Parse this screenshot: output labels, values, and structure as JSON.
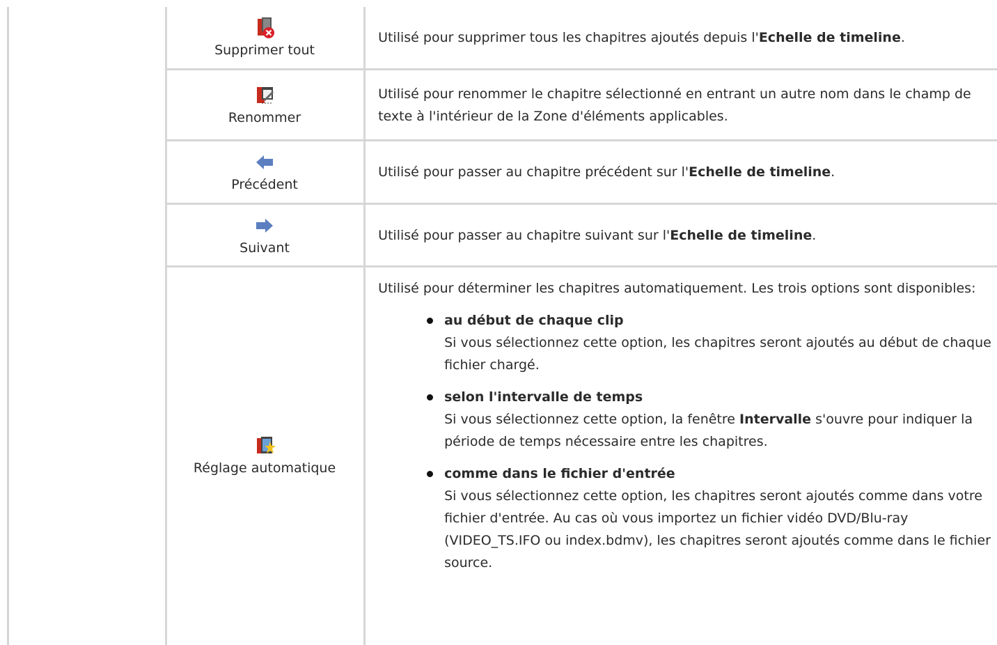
{
  "rows": [
    {
      "label": "Supprimer tout",
      "icon": "delete-all-chapters-icon",
      "desc_pre": "Utilisé pour supprimer tous les chapitres ajoutés depuis l'",
      "desc_bold": "Echelle de timeline",
      "desc_post": "."
    },
    {
      "label": "Renommer",
      "icon": "rename-chapter-icon",
      "desc": "Utilisé pour renommer le chapitre sélectionné en entrant un autre nom dans le champ de texte à l'intérieur de la Zone d'éléments applicables."
    },
    {
      "label": "Précédent",
      "icon": "previous-arrow-icon",
      "desc_pre": "Utilisé pour passer au chapitre précédent sur l'",
      "desc_bold": "Echelle de timeline",
      "desc_post": "."
    },
    {
      "label": "Suivant",
      "icon": "next-arrow-icon",
      "desc_pre": "Utilisé pour passer au chapitre suivant sur l'",
      "desc_bold": "Echelle de timeline",
      "desc_post": "."
    },
    {
      "label": "Réglage automatique",
      "icon": "auto-chapter-icon",
      "intro": "Utilisé pour déterminer les chapitres automatiquement. Les trois options sont disponibles:",
      "options": [
        {
          "title": "au début de chaque clip",
          "text": "Si vous sélectionnez cette option, les chapitres seront ajoutés au début de chaque fichier chargé."
        },
        {
          "title": "selon l'intervalle de temps",
          "text_pre": "Si vous sélectionnez cette option, la fenêtre ",
          "text_bold": "Intervalle",
          "text_post": " s'ouvre pour indiquer la période de temps nécessaire entre les chapitres."
        },
        {
          "title": "comme dans le fichier d'entrée",
          "text": "Si vous sélectionnez cette option, les chapitres seront ajoutés comme dans votre fichier d'entrée. Au cas où vous importez un fichier vidéo DVD/Blu-ray (VIDEO_TS.IFO ou index.bdmv), les chapitres seront ajoutés comme dans le fichier source."
        }
      ]
    }
  ],
  "colors": {
    "border": "#d6d6d6",
    "chapter_red": "#c62b1d",
    "arrow_blue": "#5b7fc0"
  }
}
